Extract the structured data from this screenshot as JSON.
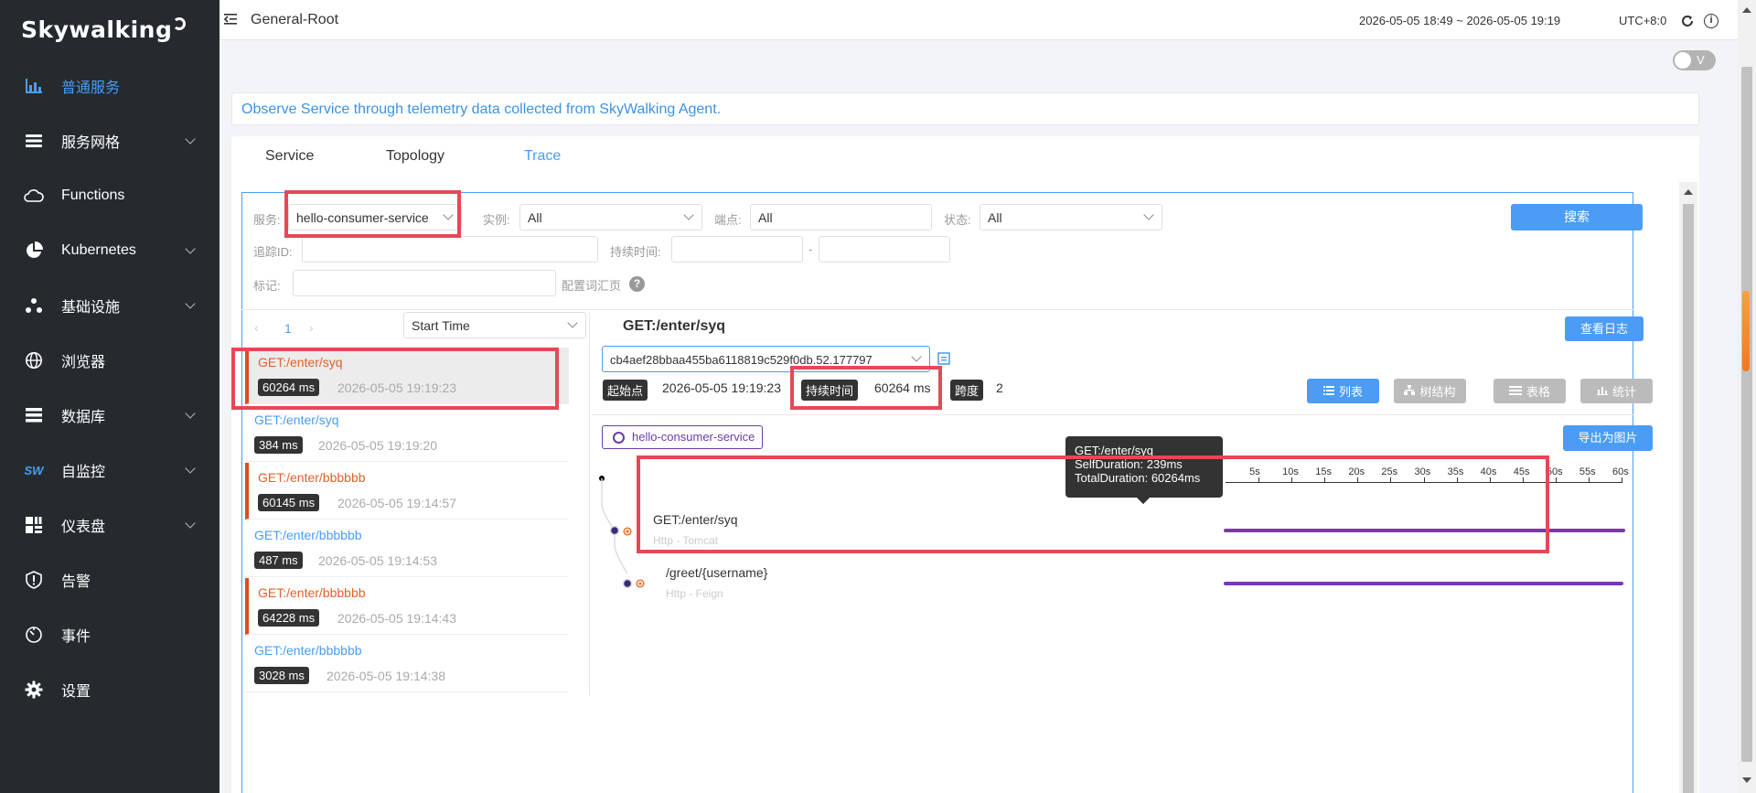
{
  "logo": {
    "text": "Skywalking"
  },
  "sidebar": {
    "items": [
      {
        "label": "普通服务",
        "icon": "bar-chart-icon",
        "active": true,
        "arrow": false
      },
      {
        "label": "服务网格",
        "icon": "layers-icon",
        "active": false,
        "arrow": true
      },
      {
        "label": "Functions",
        "icon": "cloud-icon",
        "active": false,
        "arrow": false
      },
      {
        "label": "Kubernetes",
        "icon": "pie-chart-icon",
        "active": false,
        "arrow": true
      },
      {
        "label": "基础设施",
        "icon": "nodes-icon",
        "active": false,
        "arrow": true
      },
      {
        "label": "浏览器",
        "icon": "globe-icon",
        "active": false,
        "arrow": false
      },
      {
        "label": "数据库",
        "icon": "list-icon",
        "active": false,
        "arrow": true
      },
      {
        "label": "自监控",
        "icon": "sw-icon",
        "icon_text": "SW",
        "active": false,
        "arrow": true
      },
      {
        "label": "仪表盘",
        "icon": "dashboard-icon",
        "active": false,
        "arrow": true
      },
      {
        "label": "告警",
        "icon": "alarm-icon",
        "active": false,
        "arrow": false
      },
      {
        "label": "事件",
        "icon": "timer-icon",
        "active": false,
        "arrow": false
      },
      {
        "label": "设置",
        "icon": "gear-icon",
        "active": false,
        "arrow": false
      }
    ]
  },
  "topbar": {
    "breadcrumb": "General-Root",
    "time_range": "2026-05-05 18:49 ~ 2026-05-05 19:19",
    "timezone": "UTC+8:0"
  },
  "toggle": {
    "label": "V",
    "on": false
  },
  "banner": "Observe Service through telemetry data collected from SkyWalking Agent.",
  "tabs": [
    {
      "label": "Service",
      "active": false
    },
    {
      "label": "Topology",
      "active": false
    },
    {
      "label": "Trace",
      "active": true
    }
  ],
  "filters": {
    "service_label": "服务:",
    "service_value": "hello-consumer-service",
    "instance_label": "实例:",
    "instance_value": "All",
    "endpoint_label": "端点:",
    "endpoint_value": "All",
    "status_label": "状态:",
    "status_value": "All",
    "trace_id_label": "追踪ID:",
    "duration_label": "持续时间:",
    "duration_sep": "-",
    "tags_label": "标记:",
    "tags_help_label": "配置词汇页",
    "search_button": "搜索"
  },
  "trace_list": {
    "page": "1",
    "sort_value": "Start Time",
    "rows": [
      {
        "name": "GET:/enter/syq",
        "duration": "60264 ms",
        "time": "2026-05-05 19:19:23",
        "error": true,
        "selected": true
      },
      {
        "name": "GET:/enter/syq",
        "duration": "384 ms",
        "time": "2026-05-05 19:19:20",
        "error": false,
        "selected": false
      },
      {
        "name": "GET:/enter/bbbbbb",
        "duration": "60145 ms",
        "time": "2026-05-05 19:14:57",
        "error": true,
        "selected": false
      },
      {
        "name": "GET:/enter/bbbbbb",
        "duration": "487 ms",
        "time": "2026-05-05 19:14:53",
        "error": false,
        "selected": false
      },
      {
        "name": "GET:/enter/bbbbbb",
        "duration": "64228 ms",
        "time": "2026-05-05 19:14:43",
        "error": true,
        "selected": false
      },
      {
        "name": "GET:/enter/bbbbbb",
        "duration": "3028 ms",
        "time": "2026-05-05 19:14:38",
        "error": false,
        "selected": false
      }
    ]
  },
  "detail": {
    "title": "GET:/enter/syq",
    "view_logs": "查看日志",
    "trace_id": "cb4aef28bbaa455ba6118819c529f0db.52.177797",
    "start_label": "起始点",
    "start_value": "2026-05-05 19:19:23",
    "duration_label": "持续时间",
    "duration_value": "60264 ms",
    "span_label": "跨度",
    "span_value": "2",
    "views": [
      {
        "label": "列表",
        "icon": "list-view-icon",
        "active": true
      },
      {
        "label": "树结构",
        "icon": "tree-view-icon",
        "active": false
      },
      {
        "label": "表格",
        "icon": "table-view-icon",
        "active": false
      },
      {
        "label": "统计",
        "icon": "stats-view-icon",
        "active": false
      }
    ],
    "service_chip": "hello-consumer-service",
    "export_button": "导出为图片",
    "axis_ticks": [
      "5s",
      "10s",
      "15s",
      "20s",
      "25s",
      "30s",
      "35s",
      "40s",
      "45s",
      "50s",
      "55s",
      "60s"
    ],
    "spans": [
      {
        "name": "GET:/enter/syq",
        "component": "Http - Tomcat",
        "start_s": 0,
        "end_s": 60.264
      },
      {
        "name": "/greet/{username}",
        "component": "Http - Feign",
        "start_s": 0,
        "end_s": 60.025
      }
    ],
    "tooltip": {
      "title": "GET:/enter/syq",
      "self_duration": "SelfDuration: 239ms",
      "total_duration": "TotalDuration: 60264ms"
    }
  },
  "colors": {
    "sidebar_bg": "#252a2f",
    "accent": "#4a9cf5",
    "error": "#e0602d",
    "span_bar": "#7a35b8",
    "highlight_box": "#e54857"
  }
}
